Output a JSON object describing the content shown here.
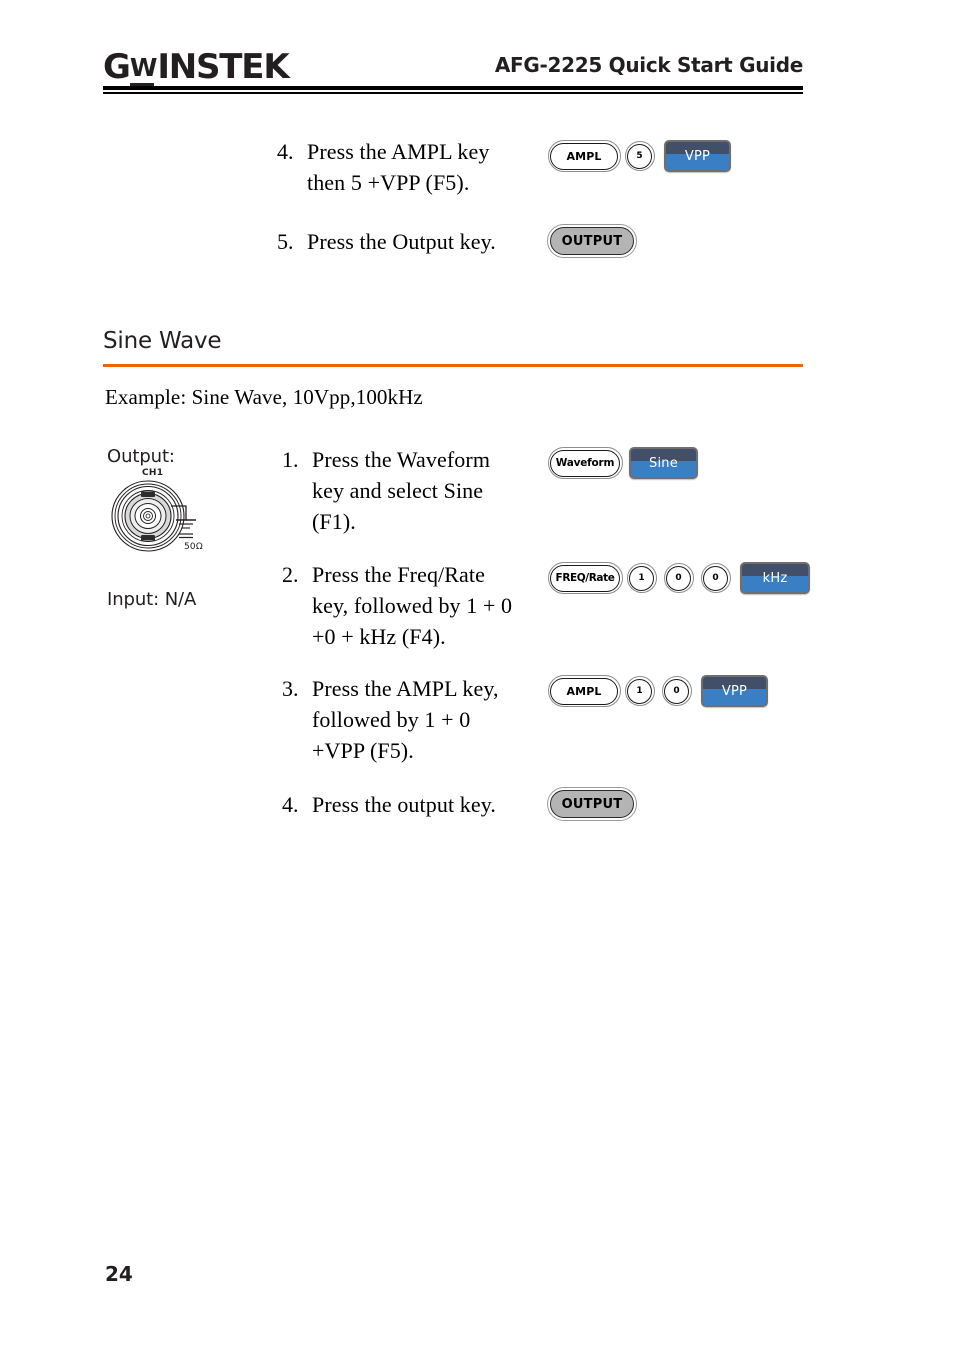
{
  "header": {
    "logo_g": "G",
    "logo_w": "W",
    "logo_rest": "INSTEK",
    "title": "AFG-2225 Quick Start Guide"
  },
  "top_steps": [
    {
      "num": "4.",
      "text": "Press the AMPL key\nthen 5 +VPP (F5).",
      "keys": [
        {
          "type": "pill",
          "label": "AMPL"
        },
        {
          "type": "round",
          "label": "5"
        },
        {
          "type": "blue",
          "label": "VPP"
        }
      ]
    },
    {
      "num": "5.",
      "text": "Press the Output key.",
      "keys": [
        {
          "type": "output",
          "label": "OUTPUT"
        }
      ]
    }
  ],
  "section": {
    "heading": "Sine Wave",
    "example": "Example: Sine Wave, 10Vpp,100kHz",
    "accent_color": "#ec6608"
  },
  "sidecol": {
    "output_label": "Output:",
    "input_label": "Input: N/A",
    "bnc_channel": "CH1",
    "bnc_impedance": "50Ω",
    "bnc_icon": "bnc-connector-icon"
  },
  "sine_steps": [
    {
      "num": "1.",
      "text": "Press the Waveform\nkey and select Sine\n(F1).",
      "keys": [
        {
          "type": "pill",
          "label": "Waveform"
        },
        {
          "type": "blue",
          "label": "Sine"
        }
      ]
    },
    {
      "num": "2.",
      "text": "Press the Freq/Rate\nkey, followed by 1 + 0\n+0 + kHz (F4).",
      "keys": [
        {
          "type": "pill",
          "label": "FREQ/Rate"
        },
        {
          "type": "round",
          "label": "1"
        },
        {
          "type": "round",
          "label": "0"
        },
        {
          "type": "round",
          "label": "0"
        },
        {
          "type": "blue",
          "label": "kHz"
        }
      ]
    },
    {
      "num": "3.",
      "text": "Press the AMPL key,\nfollowed by 1 + 0\n+VPP (F5).",
      "keys": [
        {
          "type": "pill",
          "label": "AMPL"
        },
        {
          "type": "round",
          "label": "1"
        },
        {
          "type": "round",
          "label": "0"
        },
        {
          "type": "blue",
          "label": "VPP"
        }
      ]
    },
    {
      "num": "4.",
      "text": "Press the output key.",
      "keys": [
        {
          "type": "output",
          "label": "OUTPUT"
        }
      ]
    }
  ],
  "footer": {
    "page_number": "24"
  }
}
